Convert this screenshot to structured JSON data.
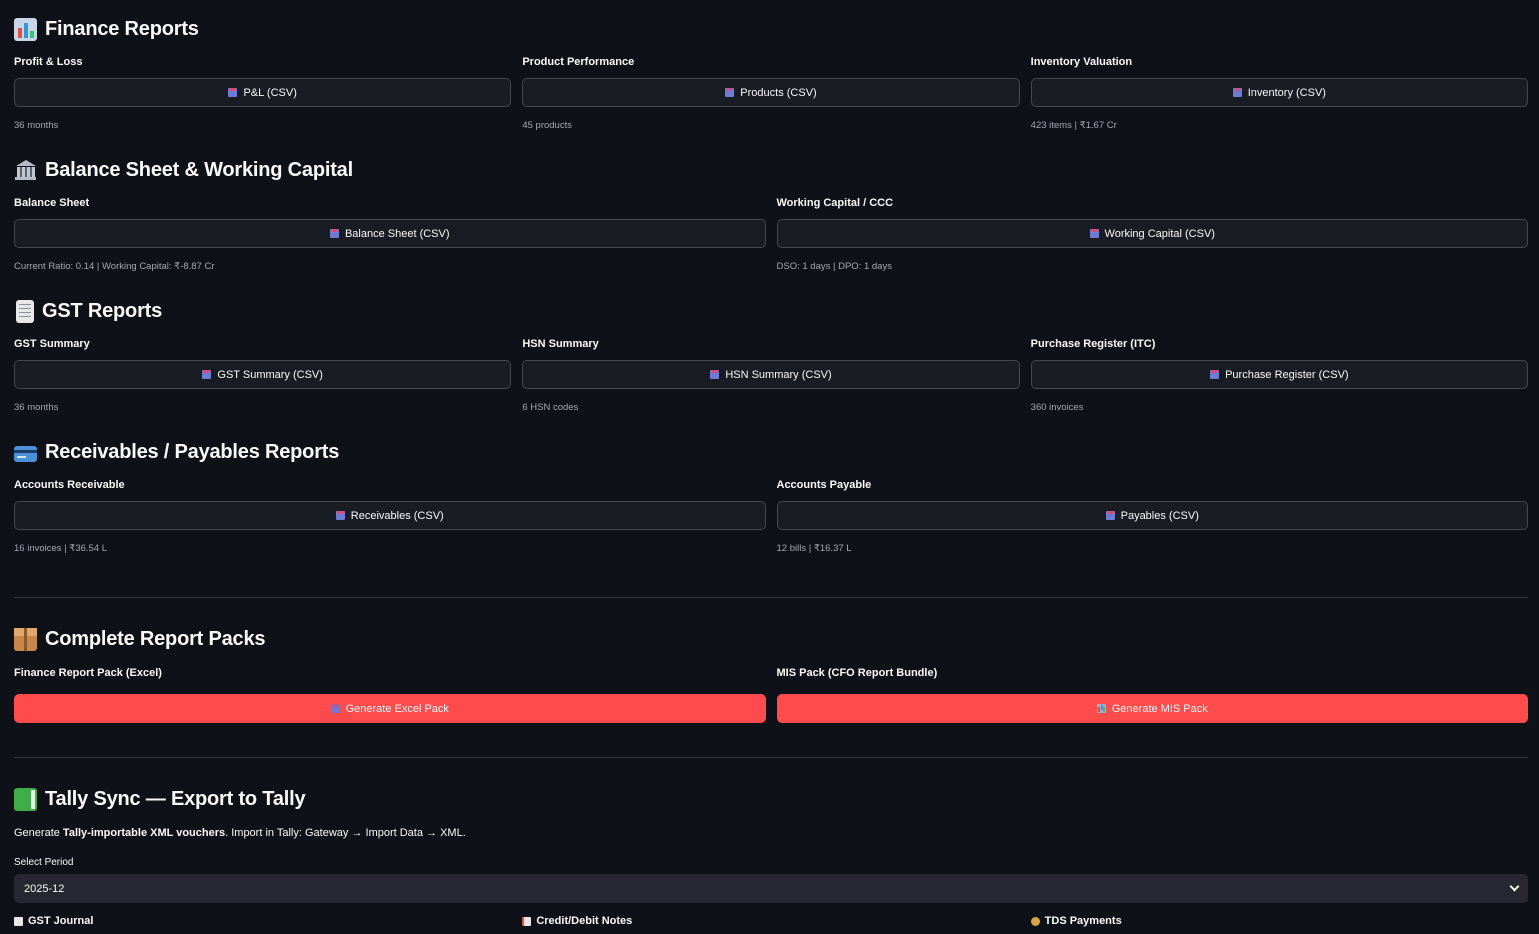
{
  "finance": {
    "title": "Finance Reports",
    "items": [
      {
        "label": "Profit & Loss",
        "button": "P&L (CSV)",
        "caption": "36 months"
      },
      {
        "label": "Product Performance",
        "button": "Products (CSV)",
        "caption": "45 products"
      },
      {
        "label": "Inventory Valuation",
        "button": "Inventory (CSV)",
        "caption": "423 items | ₹1.67 Cr"
      }
    ]
  },
  "balance": {
    "title": "Balance Sheet & Working Capital",
    "items": [
      {
        "label": "Balance Sheet",
        "button": "Balance Sheet (CSV)",
        "caption": "Current Ratio: 0.14 | Working Capital: ₹-8.87 Cr"
      },
      {
        "label": "Working Capital / CCC",
        "button": "Working Capital (CSV)",
        "caption": "DSO: 1 days | DPO: 1 days"
      }
    ]
  },
  "gst": {
    "title": "GST Reports",
    "items": [
      {
        "label": "GST Summary",
        "button": "GST Summary (CSV)",
        "caption": "36 months"
      },
      {
        "label": "HSN Summary",
        "button": "HSN Summary (CSV)",
        "caption": "6 HSN codes"
      },
      {
        "label": "Purchase Register (ITC)",
        "button": "Purchase Register (CSV)",
        "caption": "360 invoices"
      }
    ]
  },
  "recv": {
    "title": "Receivables / Payables Reports",
    "items": [
      {
        "label": "Accounts Receivable",
        "button": "Receivables (CSV)",
        "caption": "16 invoices | ₹36.54 L"
      },
      {
        "label": "Accounts Payable",
        "button": "Payables (CSV)",
        "caption": "12 bills | ₹16.37 L"
      }
    ]
  },
  "packs": {
    "title": "Complete Report Packs",
    "items": [
      {
        "label": "Finance Report Pack (Excel)",
        "button": "Generate Excel Pack"
      },
      {
        "label": "MIS Pack (CFO Report Bundle)",
        "button": "Generate MIS Pack"
      }
    ]
  },
  "tally": {
    "title": "Tally Sync — Export to Tally",
    "desc_prefix": "Generate ",
    "desc_bold": "Tally-importable XML vouchers",
    "desc_suffix": ". Import in Tally: Gateway → Import Data → XML.",
    "period_label": "Select Period",
    "period_value": "2025-12",
    "subs": [
      "GST Journal",
      "Credit/Debit Notes",
      "TDS Payments"
    ]
  },
  "colors": {
    "background": "#0e1117",
    "primary": "#ff4b4b",
    "secondary_button": "#1a1c24"
  }
}
